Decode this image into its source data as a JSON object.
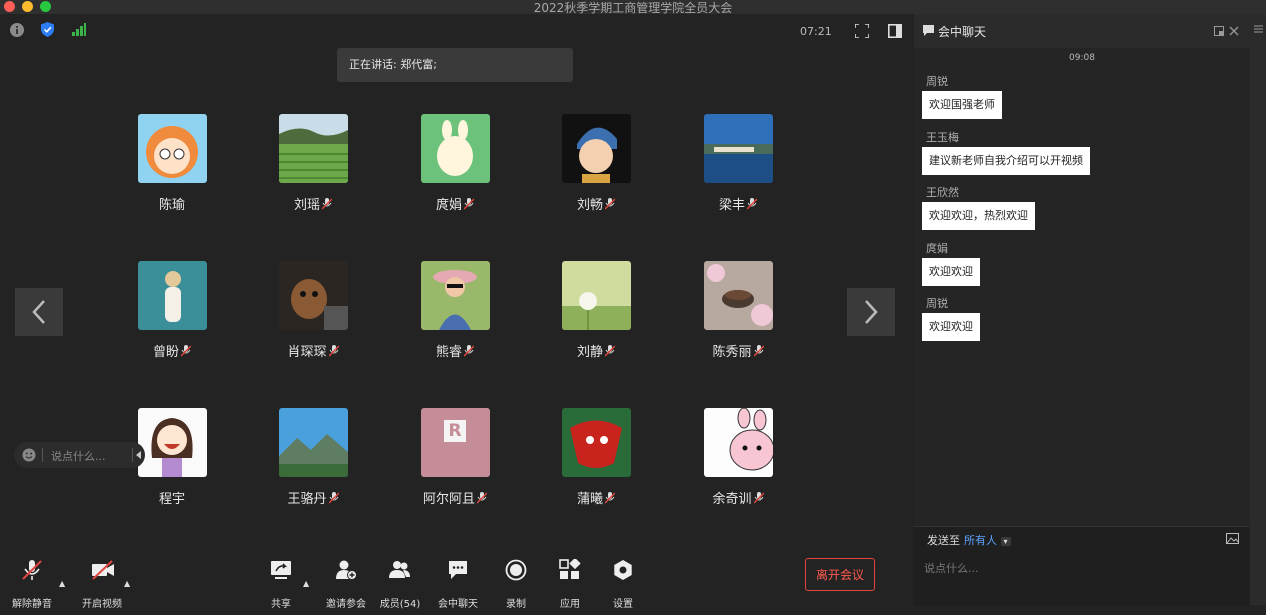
{
  "window": {
    "title": "2022秋季学期工商管理学院全员大会"
  },
  "topbar": {
    "time": "07:21"
  },
  "speaker": {
    "text": "正在讲话: 郑代富;"
  },
  "participants": [
    {
      "name": "陈瑜",
      "muted": false,
      "avatar": "cartoon-girl-avatar"
    },
    {
      "name": "刘瑶",
      "muted": true,
      "avatar": "rice-field-avatar"
    },
    {
      "name": "庹娟",
      "muted": true,
      "avatar": "bunny-cartoon-avatar"
    },
    {
      "name": "刘畅",
      "muted": true,
      "avatar": "pearl-earring-girl-avatar"
    },
    {
      "name": "梁丰",
      "muted": true,
      "avatar": "lake-landscape-avatar"
    },
    {
      "name": "曾盼",
      "muted": true,
      "avatar": "girl-teal-background-avatar"
    },
    {
      "name": "肖琛琛",
      "muted": true,
      "avatar": "dog-photo-avatar"
    },
    {
      "name": "熊睿",
      "muted": true,
      "avatar": "woman-hat-avatar"
    },
    {
      "name": "刘静",
      "muted": true,
      "avatar": "dandelion-avatar"
    },
    {
      "name": "陈秀丽",
      "muted": true,
      "avatar": "teacup-flowers-avatar"
    },
    {
      "name": "程宇",
      "muted": false,
      "avatar": "laughing-girl-avatar"
    },
    {
      "name": "王骆丹",
      "muted": true,
      "avatar": "mountain-sky-avatar"
    },
    {
      "name": "阿尔阿且",
      "muted": true,
      "avatar": "pink-letter-r-avatar"
    },
    {
      "name": "蒲曦",
      "muted": true,
      "avatar": "red-dragon-avatar"
    },
    {
      "name": "余奇训",
      "muted": true,
      "avatar": "pink-bunny-avatar"
    }
  ],
  "avatar_letter": "R",
  "chat_input_overlay": {
    "placeholder": "说点什么..."
  },
  "toolbar": {
    "unmute": "解除静音",
    "start_video": "开启视频",
    "share": "共享",
    "invite": "邀请参会",
    "members": "成员(54)",
    "chat": "会中聊天",
    "record": "录制",
    "apps": "应用",
    "settings": "设置",
    "leave": "离开会议"
  },
  "chat_panel": {
    "title": "会中聊天",
    "time": "09:08",
    "messages": [
      {
        "sender": "周锐",
        "text": "欢迎国强老师"
      },
      {
        "sender": "王玉梅",
        "text": "建议新老师自我介绍可以开视频"
      },
      {
        "sender": "王欣然",
        "text": "欢迎欢迎，热烈欢迎"
      },
      {
        "sender": "庹娟",
        "text": "欢迎欢迎"
      },
      {
        "sender": "周锐",
        "text": "欢迎欢迎"
      }
    ],
    "send_to_label": "发送至",
    "send_target": "所有人",
    "input_placeholder": "说点什么..."
  },
  "colors": {
    "leave_red": "#e0463d",
    "accent_blue": "#5ea2ff",
    "background": "#232323"
  }
}
